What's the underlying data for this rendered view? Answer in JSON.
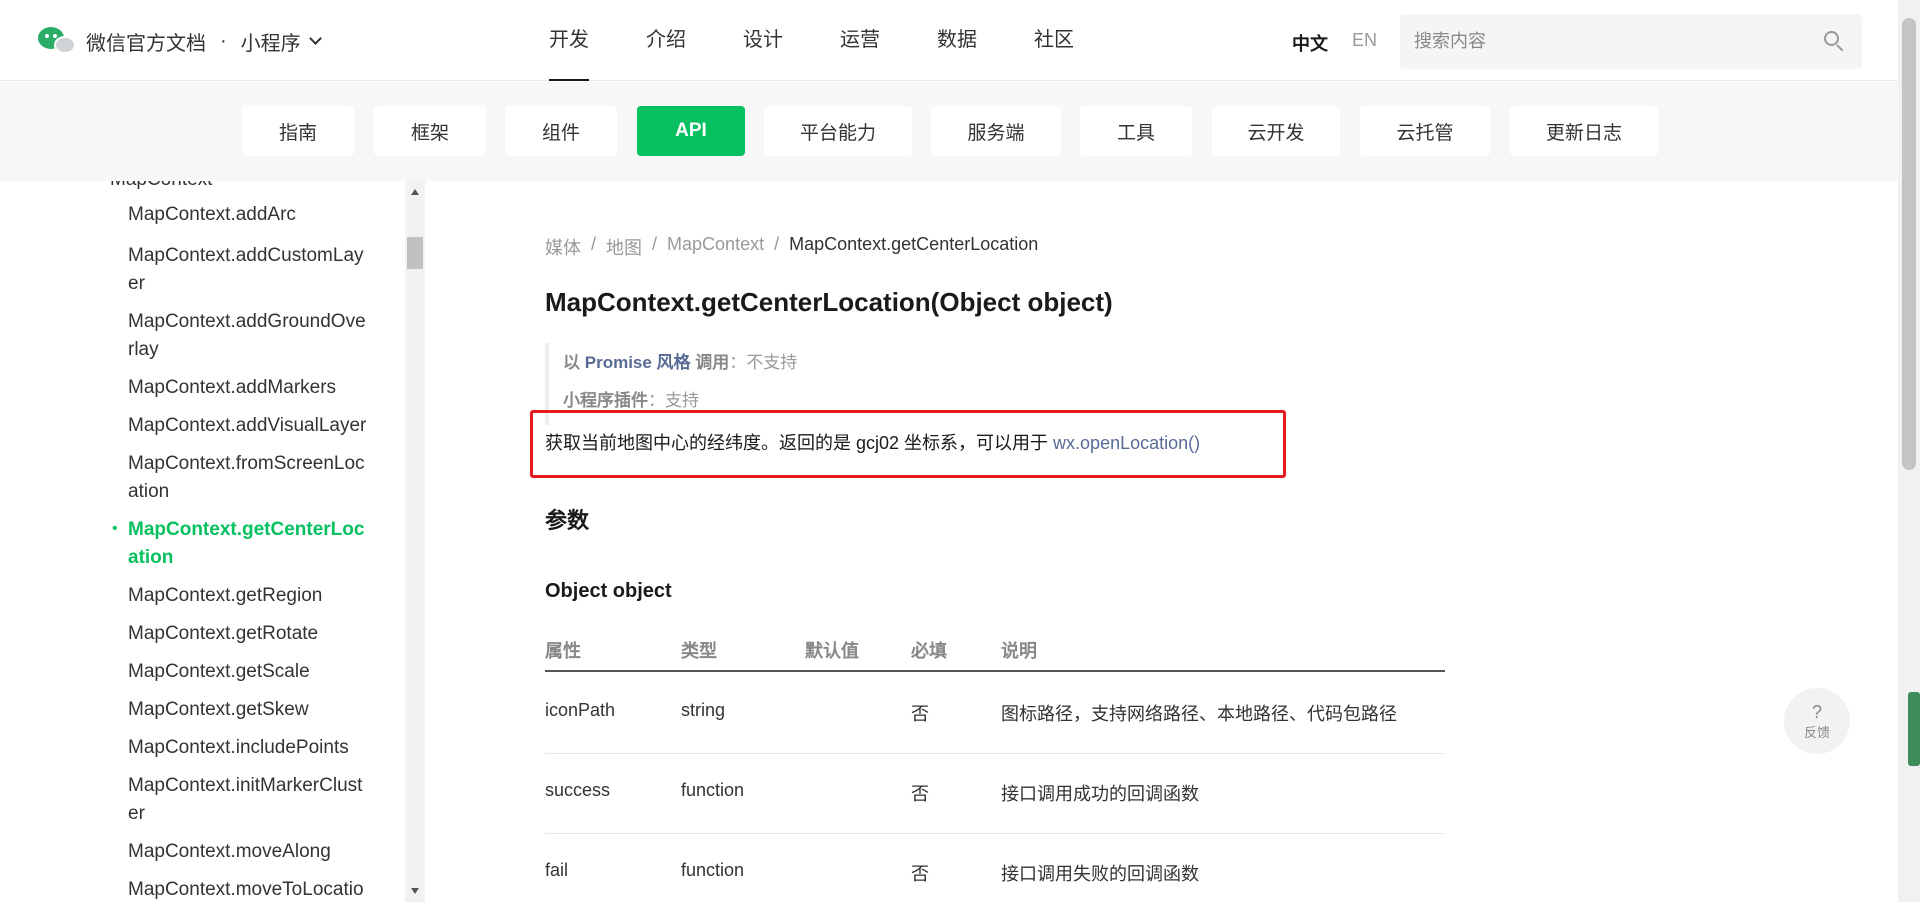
{
  "header": {
    "brand_title": "微信官方文档",
    "brand_dot": "·",
    "brand_sub": "小程序",
    "nav": [
      "开发",
      "介绍",
      "设计",
      "运营",
      "数据",
      "社区"
    ],
    "lang_zh": "中文",
    "lang_en": "EN",
    "search_placeholder": "搜索内容"
  },
  "sub_nav": [
    "指南",
    "框架",
    "组件",
    "API",
    "平台能力",
    "服务端",
    "工具",
    "云开发",
    "云托管",
    "更新日志"
  ],
  "sidebar": {
    "parent": "MapContext",
    "items": [
      "MapContext.addArc",
      "MapContext.addCustomLayer",
      "MapContext.addGroundOverlay",
      "MapContext.addMarkers",
      "MapContext.addVisualLayer",
      "MapContext.fromScreenLocation",
      "MapContext.getCenterLocation",
      "MapContext.getRegion",
      "MapContext.getRotate",
      "MapContext.getScale",
      "MapContext.getSkew",
      "MapContext.includePoints",
      "MapContext.initMarkerCluster",
      "MapContext.moveAlong",
      "MapContext.moveToLocatio"
    ],
    "bullet": "•"
  },
  "breadcrumb": [
    "媒体",
    "地图",
    "MapContext",
    "MapContext.getCenterLocation"
  ],
  "breadcrumb_sep": "/",
  "page_title": "MapContext.getCenterLocation(Object object)",
  "quote": {
    "line1_prefix": "以 ",
    "line1_link": "Promise 风格",
    "line1_label": " 调用",
    "line1_value": "：不支持",
    "line2_label": "小程序插件",
    "line2_value": "：支持"
  },
  "description": {
    "text": "获取当前地图中心的经纬度。返回的是 gcj02 坐标系，可以用于 ",
    "link": "wx.openLocation()"
  },
  "params_heading": "参数",
  "object_heading": "Object object",
  "table": {
    "headers": [
      "属性",
      "类型",
      "默认值",
      "必填",
      "说明"
    ],
    "rows": [
      [
        "iconPath",
        "string",
        "",
        "否",
        "图标路径，支持网络路径、本地路径、代码包路径"
      ],
      [
        "success",
        "function",
        "",
        "否",
        "接口调用成功的回调函数"
      ],
      [
        "fail",
        "function",
        "",
        "否",
        "接口调用失败的回调函数"
      ]
    ]
  },
  "feedback": {
    "icon": "?",
    "label": "反馈"
  },
  "colors": {
    "accent": "#07c160",
    "link": "#576b95",
    "highlight": "#e8191e"
  }
}
